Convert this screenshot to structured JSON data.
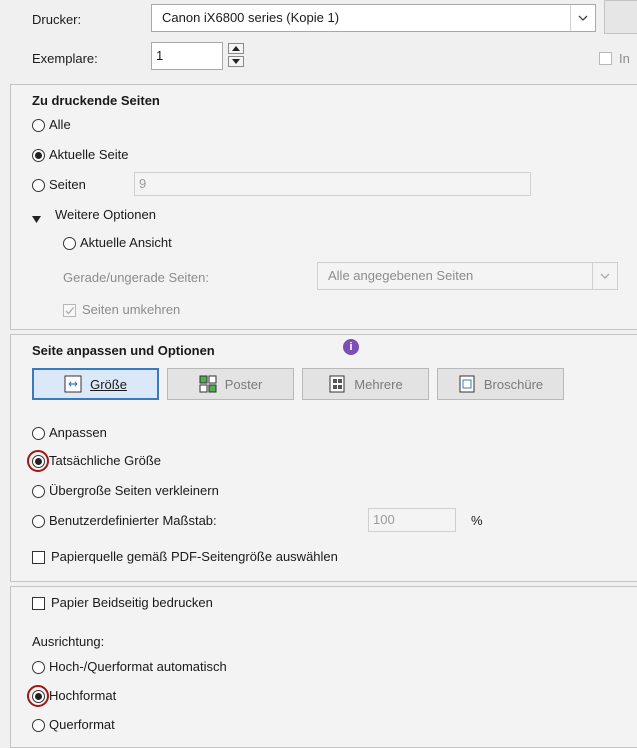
{
  "printer": {
    "label": "Drucker:",
    "value": "Canon iX6800 series (Kopie 1)"
  },
  "copies": {
    "label": "Exemplare:",
    "value": "1"
  },
  "grayscale_fragment": "In",
  "pages": {
    "heading": "Zu druckende Seiten",
    "all": "Alle",
    "current": "Aktuelle Seite",
    "pages_label": "Seiten",
    "pages_value": "9",
    "more_options": "Weitere Optionen",
    "current_view": "Aktuelle Ansicht",
    "odd_even_label": "Gerade/ungerade Seiten:",
    "odd_even_value": "Alle angegebenen Seiten",
    "reverse": "Seiten umkehren"
  },
  "sizing": {
    "heading": "Seite anpassen und Optionen",
    "buttons": [
      "Größe",
      "Poster",
      "Mehrere",
      "Broschüre"
    ],
    "fit": "Anpassen",
    "actual": "Tatsächliche Größe",
    "shrink": "Übergroße Seiten verkleinern",
    "custom": "Benutzerdefinierter Maßstab:",
    "scale_value": "100",
    "percent": "%",
    "paper_source": "Papierquelle gemäß PDF-Seitengröße auswählen"
  },
  "duplex": {
    "label": "Papier Beidseitig bedrucken"
  },
  "orientation": {
    "heading": "Ausrichtung:",
    "auto": "Hoch-/Querformat automatisch",
    "portrait": "Hochformat",
    "landscape": "Querformat"
  },
  "colors": {
    "accent": "#3a78c2",
    "highlight": "#a31515",
    "info": "#7b4fb3"
  }
}
